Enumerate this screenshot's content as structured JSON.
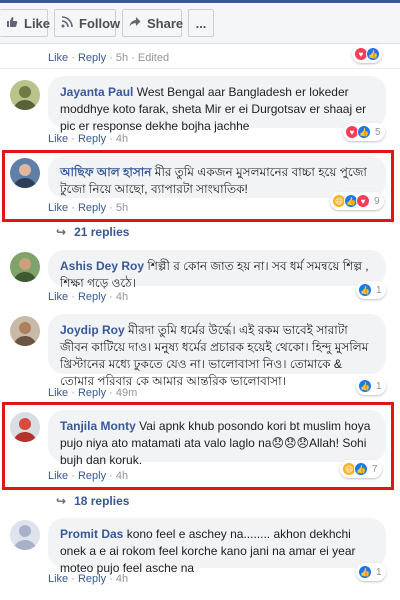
{
  "toolbar": {
    "like_label": "Like",
    "follow_label": "Follow",
    "share_label": "Share",
    "more_label": "..."
  },
  "colors": {
    "link": "#385898",
    "highlight": "#e01515",
    "like": "#1877f2",
    "love": "#f33e58",
    "haha": "#f7b125"
  },
  "top_meta": {
    "like": "Like",
    "reply": "Reply",
    "time": "5h",
    "edited": "Edited"
  },
  "comments": [
    {
      "author": "Jayanta Paul",
      "text": "West Bengal aar Bangladesh er lokeder moddhye koto farak, sheta Mir er ei Durgotsav er shaaj er pic er response dekhe bojha jachhe",
      "like": "Like",
      "reply": "Reply",
      "time": "4h",
      "reaction_icons": [
        "love",
        "like"
      ],
      "reaction_count": "5"
    },
    {
      "author": "আছিফ আল হাসান",
      "text": "মীর তুমি একজন মুসলমানের বাচ্চা হয়ে পুজো টুজো নিয়ে আছো, ব্যাপারটা সাংঘাতিক!",
      "like": "Like",
      "reply": "Reply",
      "time": "5h",
      "reaction_icons": [
        "haha",
        "like",
        "love"
      ],
      "reaction_count": "9",
      "replies_label": "21 replies",
      "highlighted": true
    },
    {
      "author": "Ashis Dey Roy",
      "text": "শিল্পী র কোন জাত হয় না। সব ধর্ম সমন্বয়ে শিল্প , শিক্ষা গড়ে ওঠে।",
      "like": "Like",
      "reply": "Reply",
      "time": "4h",
      "reaction_icons": [
        "like"
      ],
      "reaction_count": "1"
    },
    {
      "author": "Joydip Roy",
      "text": "মীরদা তুমি ধর্মের উর্দ্ধে। এই রকম ভাবেই সারাটা জীবন কাটিয়ে দাও। মনুষ্য ধর্মের প্রচারক হয়েই থেকো। হিন্দু মুসলিম খ্রিস্টানের মধ্যে ঢুকতে যেও না। ভালোবাসা নিও। তোমাকে & তোমার পরিবার কে আমার আন্তরিক ভালোবাসা।",
      "like": "Like",
      "reply": "Reply",
      "time": "49m",
      "reaction_icons": [
        "like"
      ],
      "reaction_count": "1"
    },
    {
      "author": "Tanjila Monty",
      "text": "Vai apnk khub posondo kori bt muslim hoya pujo niya ato matamati ata valo laglo na😞😞😞Allah! Sohi bujh dan koruk.",
      "like": "Like",
      "reply": "Reply",
      "time": "4h",
      "reaction_icons": [
        "haha",
        "like"
      ],
      "reaction_count": "7",
      "replies_label": "18 replies",
      "highlighted": true
    },
    {
      "author": "Promit Das",
      "text": "kono feel e aschey na........ akhon dekhchi onek a e ai rokom feel korche kano jani na amar ei year moteo pujo feel asche na",
      "like": "Like",
      "reply": "Reply",
      "time": "4h",
      "reaction_icons": [
        "like"
      ],
      "reaction_count": "1"
    }
  ]
}
